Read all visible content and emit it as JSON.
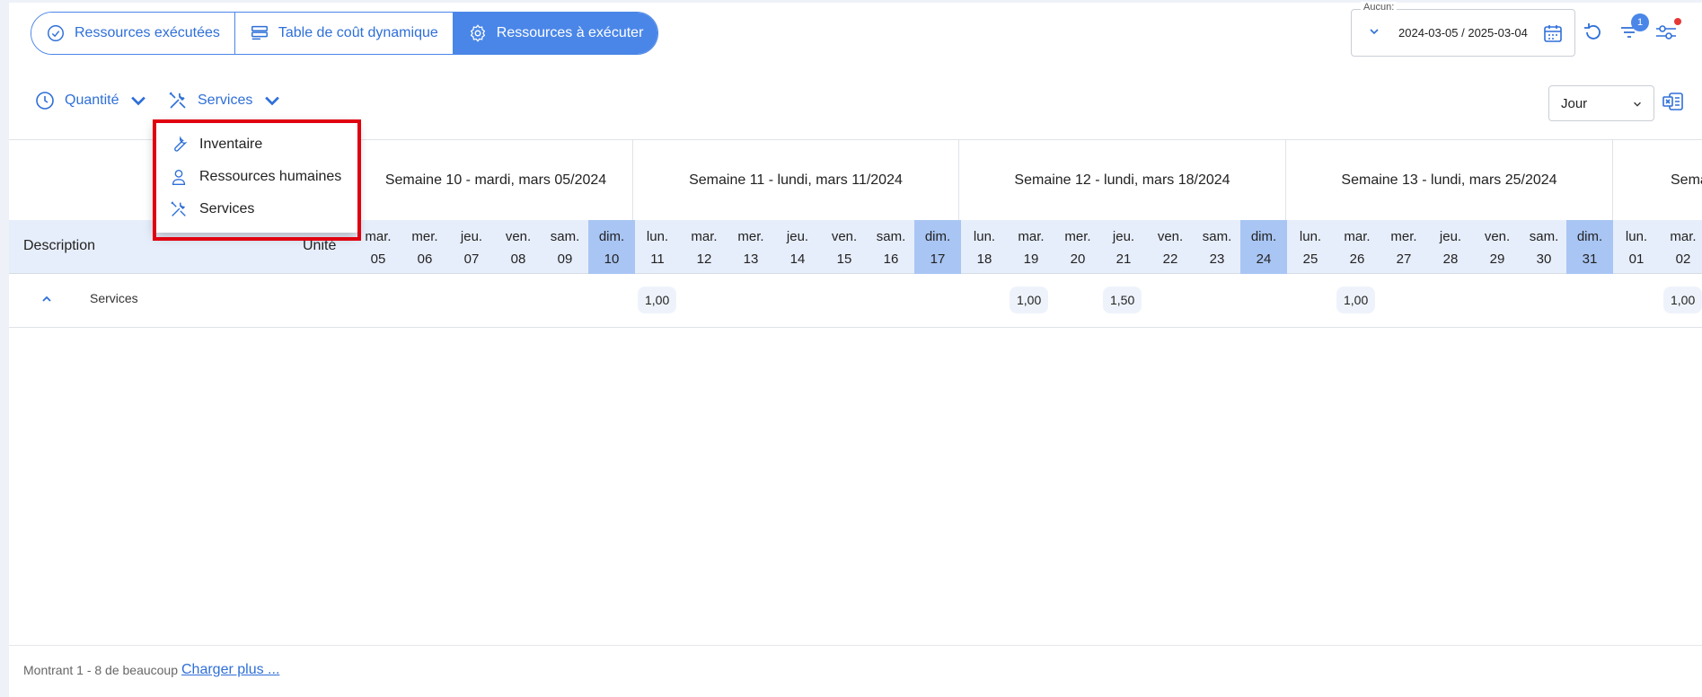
{
  "tabs": [
    {
      "label": "Ressources exécutées",
      "icon": "check-circle-icon",
      "active": false
    },
    {
      "label": "Table de coût dynamique",
      "icon": "table-icon",
      "active": false
    },
    {
      "label": "Ressources à exécuter",
      "icon": "gear-icon",
      "active": true
    }
  ],
  "date_filter": {
    "legend": "Aucun:",
    "value": "2024-03-05 / 2025-03-04"
  },
  "filter_badge": "1",
  "toolbar": {
    "quantity_label": "Quantité",
    "services_label": "Services",
    "period_select": "Jour"
  },
  "menu": {
    "items": [
      {
        "label": "Inventaire",
        "icon": "wrench-icon"
      },
      {
        "label": "Ressources humaines",
        "icon": "person-icon"
      },
      {
        "label": "Services",
        "icon": "tools-icon"
      }
    ]
  },
  "grid": {
    "description_header": "Description",
    "unit_header": "Unité",
    "weeks": [
      "Semaine 10 - mardi, mars 05/2024",
      "Semaine 11 - lundi, mars 11/2024",
      "Semaine 12 - lundi, mars 18/2024",
      "Semaine 13 - lundi, mars 25/2024",
      "Sema"
    ],
    "days": [
      {
        "name": "mar.",
        "num": "05"
      },
      {
        "name": "mer.",
        "num": "06"
      },
      {
        "name": "jeu.",
        "num": "07"
      },
      {
        "name": "ven.",
        "num": "08"
      },
      {
        "name": "sam.",
        "num": "09"
      },
      {
        "name": "dim.",
        "num": "10"
      },
      {
        "name": "lun.",
        "num": "11"
      },
      {
        "name": "mar.",
        "num": "12"
      },
      {
        "name": "mer.",
        "num": "13"
      },
      {
        "name": "jeu.",
        "num": "14"
      },
      {
        "name": "ven.",
        "num": "15"
      },
      {
        "name": "sam.",
        "num": "16"
      },
      {
        "name": "dim.",
        "num": "17"
      },
      {
        "name": "lun.",
        "num": "18"
      },
      {
        "name": "mar.",
        "num": "19"
      },
      {
        "name": "mer.",
        "num": "20"
      },
      {
        "name": "jeu.",
        "num": "21"
      },
      {
        "name": "ven.",
        "num": "22"
      },
      {
        "name": "sam.",
        "num": "23"
      },
      {
        "name": "dim.",
        "num": "24"
      },
      {
        "name": "lun.",
        "num": "25"
      },
      {
        "name": "mar.",
        "num": "26"
      },
      {
        "name": "mer.",
        "num": "27"
      },
      {
        "name": "jeu.",
        "num": "28"
      },
      {
        "name": "ven.",
        "num": "29"
      },
      {
        "name": "sam.",
        "num": "30"
      },
      {
        "name": "dim.",
        "num": "31"
      },
      {
        "name": "lun.",
        "num": "01"
      },
      {
        "name": "mar.",
        "num": "02"
      }
    ],
    "group_label": "Services",
    "values": [
      "1,00",
      "1,00",
      "1,50",
      "1,00",
      "1,00"
    ]
  },
  "footer": {
    "summary": "Montrant 1 - 8 de beaucoup",
    "load_more": "Charger plus ..."
  },
  "colors": {
    "accent": "#4a86e8",
    "highlight": "#e0000f",
    "sunday": "#a9c5f3"
  }
}
